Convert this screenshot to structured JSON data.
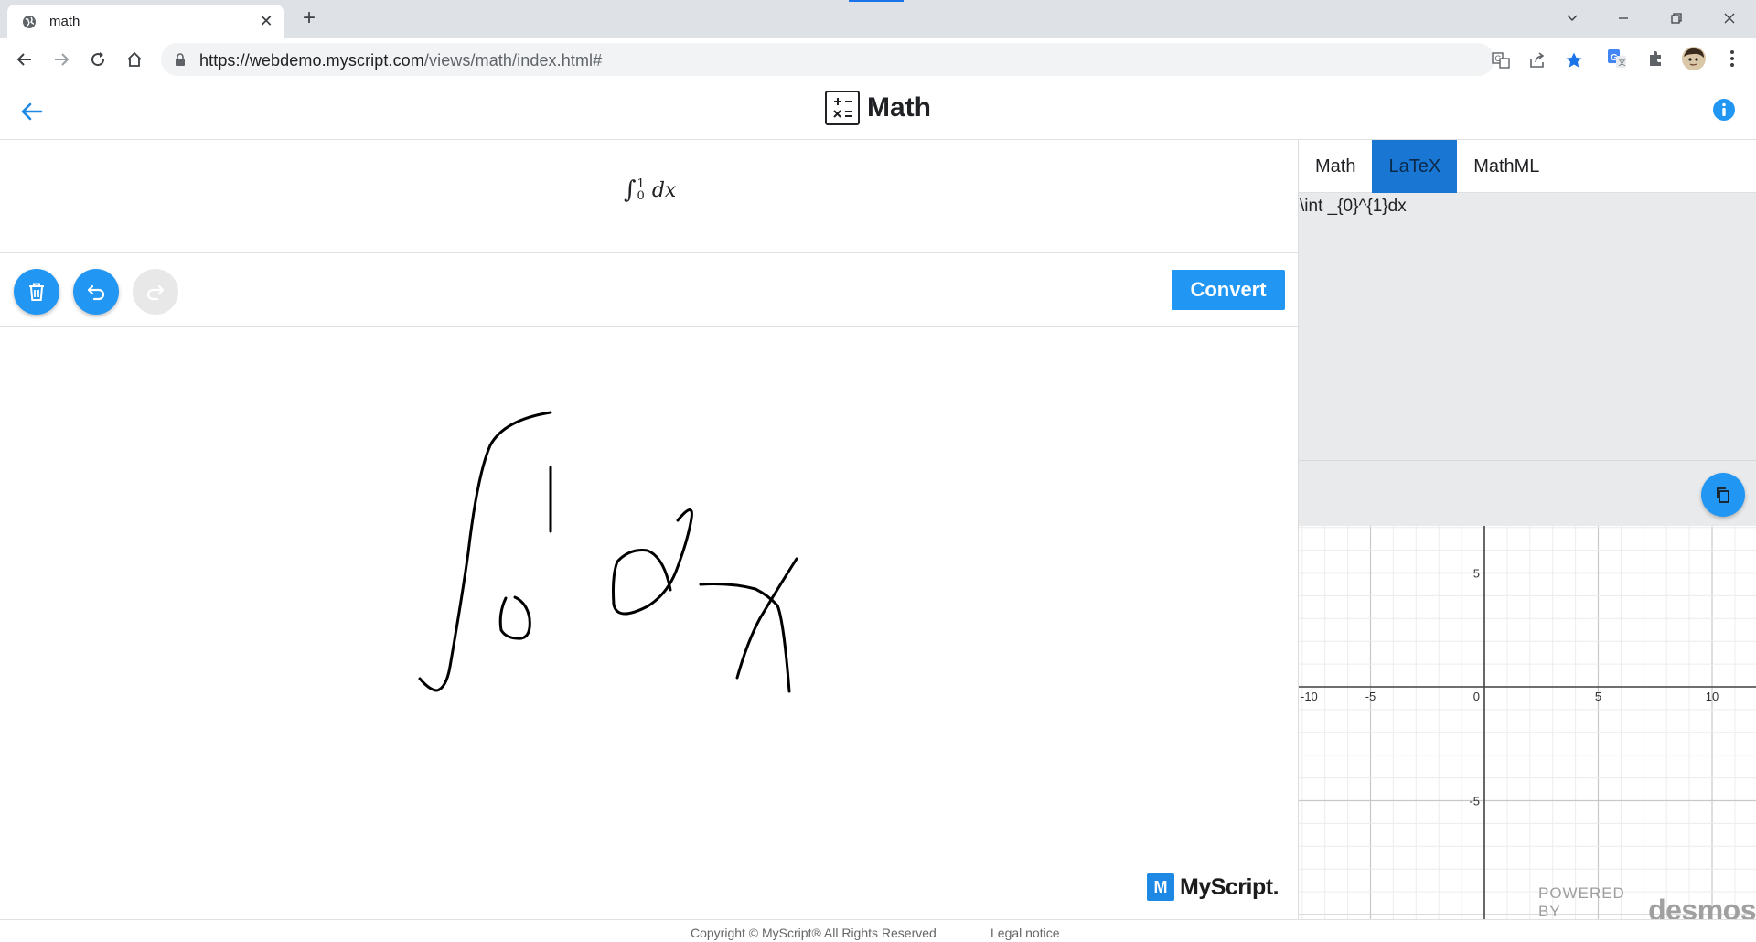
{
  "browser": {
    "tab_title": "math",
    "new_tab_symbol": "+",
    "tab_close_symbol": "✕",
    "url_host": "https://webdemo.myscript.com",
    "url_path": "/views/math/index.html#",
    "window_controls": [
      "chevron-down",
      "minimize",
      "restore",
      "close"
    ]
  },
  "header": {
    "title": "Math",
    "back_icon": "arrow-left-icon",
    "info_icon": "info-icon"
  },
  "result": {
    "integral_sign": "∫",
    "upper_limit": "1",
    "lower_limit": "0",
    "integrand": "dx"
  },
  "actions": {
    "clear_icon": "trash-icon",
    "undo_icon": "undo-icon",
    "redo_icon": "redo-icon",
    "redo_enabled": false,
    "convert_label": "Convert"
  },
  "branding": {
    "logo_mark": "M",
    "logo_word": "MyScript."
  },
  "output_panel": {
    "tabs": [
      {
        "label": "Math",
        "active": false
      },
      {
        "label": "LaTeX",
        "active": true
      },
      {
        "label": "MathML",
        "active": false
      }
    ],
    "latex_output": "\\int _{0}^{1}dx",
    "copy_icon": "copy-icon"
  },
  "graph": {
    "x_ticks": [
      "-10",
      "-5",
      "0",
      "5",
      "10"
    ],
    "y_ticks": [
      "5",
      "-5"
    ],
    "powered_by": "POWERED BY",
    "powered_brand": "desmos"
  },
  "footer": {
    "copyright": "Copyright © MyScript® All Rights Reserved",
    "legal": "Legal notice"
  },
  "colors": {
    "accent": "#2196f3",
    "active_tab": "#1976d2",
    "panel_bg": "#e9eaeb"
  }
}
